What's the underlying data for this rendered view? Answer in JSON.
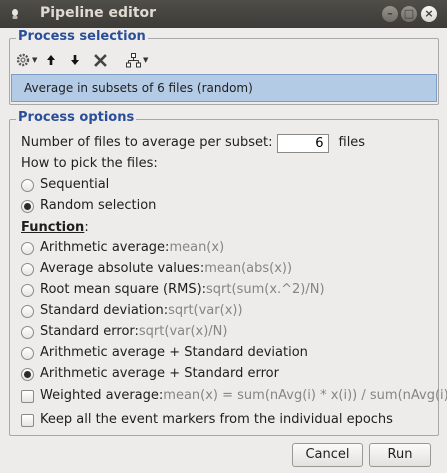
{
  "window": {
    "title": "Pipeline editor"
  },
  "process_selection": {
    "title": "Process selection",
    "toolbar_icons": [
      "gear-icon",
      "move-up-icon",
      "move-down-icon",
      "delete-icon",
      "tree-icon"
    ],
    "selected_process": "Average in subsets of 6 files (random)"
  },
  "process_options": {
    "title": "Process options",
    "subset_label": "Number of files to average per subset:",
    "subset_value": "6",
    "subset_unit": "files",
    "pick_label": "How to pick the files:",
    "pick_options": [
      {
        "label": "Sequential",
        "selected": false
      },
      {
        "label": "Random selection",
        "selected": true
      }
    ],
    "function_label": "Function",
    "function_colon": ":",
    "functions": [
      {
        "label": "Arithmetic average: ",
        "hint": "mean(x)",
        "selected": false
      },
      {
        "label": "Average absolute values: ",
        "hint": "mean(abs(x))",
        "selected": false
      },
      {
        "label": "Root mean square (RMS): ",
        "hint": "sqrt(sum(x.^2)/N)",
        "selected": false
      },
      {
        "label": "Standard deviation: ",
        "hint": "sqrt(var(x))",
        "selected": false
      },
      {
        "label": "Standard error: ",
        "hint": "sqrt(var(x)/N)",
        "selected": false
      },
      {
        "label": "Arithmetic average + Standard deviation",
        "hint": "",
        "selected": false
      },
      {
        "label": "Arithmetic average + Standard error",
        "hint": "",
        "selected": true
      }
    ],
    "weighted": {
      "label": "Weighted average: ",
      "hint": "mean(x) = sum(nAvg(i) * x(i)) / sum(nAvg(i))",
      "checked": false
    },
    "keep_markers": {
      "label": "Keep all the event markers from the individual epochs",
      "checked": false
    }
  },
  "buttons": {
    "cancel": "Cancel",
    "run": "Run"
  }
}
